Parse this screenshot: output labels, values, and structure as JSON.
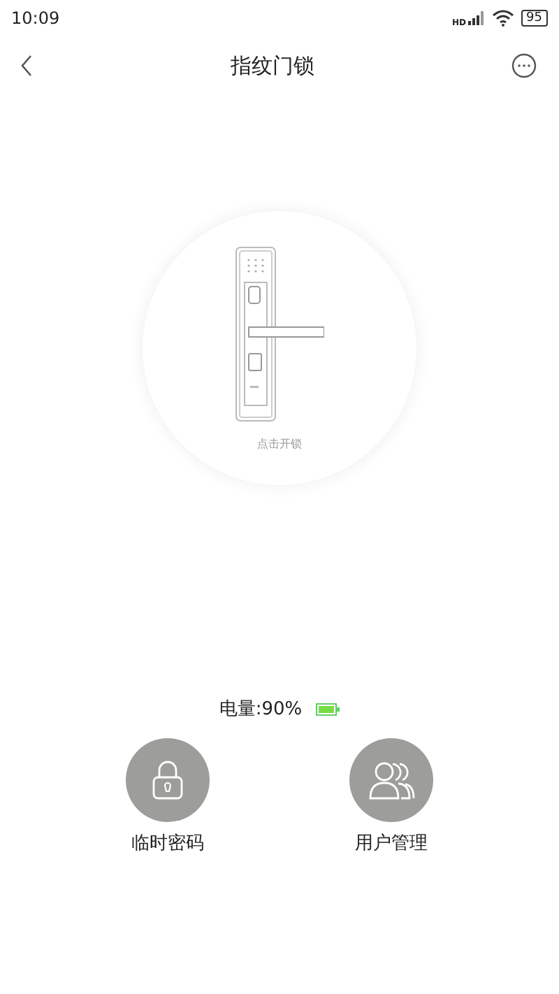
{
  "status_bar": {
    "time": "10:09",
    "network": "HD",
    "battery": "95"
  },
  "header": {
    "title": "指纹门锁"
  },
  "lock": {
    "hint": "点击开锁"
  },
  "battery": {
    "label": "电量:90%"
  },
  "actions": [
    {
      "kind": "password",
      "label": "临时密码"
    },
    {
      "kind": "users",
      "label": "用户管理"
    }
  ]
}
